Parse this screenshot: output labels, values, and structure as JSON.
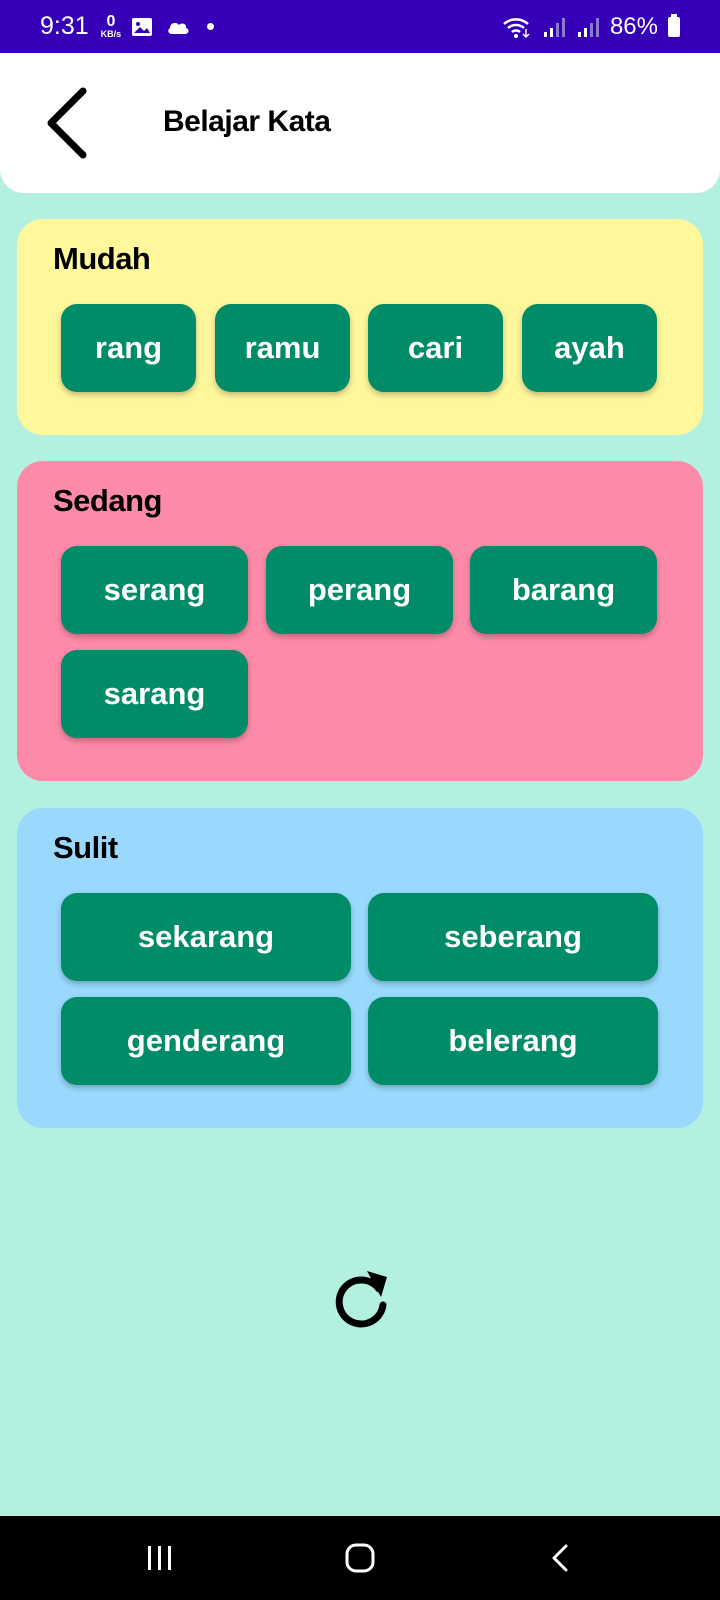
{
  "status_bar": {
    "time": "9:31",
    "net_speed_value": "0",
    "net_speed_unit": "KB/s",
    "battery": "86%",
    "icons": [
      "gallery-icon",
      "cloud-icon",
      "wifi-icon",
      "signal-icon",
      "signal-icon",
      "battery-icon"
    ]
  },
  "header": {
    "title": "Belajar Kata",
    "back_icon": "chevron-left-icon"
  },
  "levels": [
    {
      "title": "Mudah",
      "color": "#fff79c",
      "words": [
        "rang",
        "ramu",
        "cari",
        "ayah"
      ]
    },
    {
      "title": "Sedang",
      "color": "#fd8aa8",
      "words": [
        "serang",
        "perang",
        "barang",
        "sarang"
      ]
    },
    {
      "title": "Sulit",
      "color": "#9ad9fd",
      "words": [
        "sekarang",
        "seberang",
        "genderang",
        "belerang"
      ]
    }
  ],
  "button_color": "#008c68",
  "background_color": "#b4f0e0",
  "refresh_icon": "refresh-icon",
  "nav_bar": {
    "icons": [
      "recent-apps-icon",
      "home-icon",
      "back-icon"
    ]
  }
}
